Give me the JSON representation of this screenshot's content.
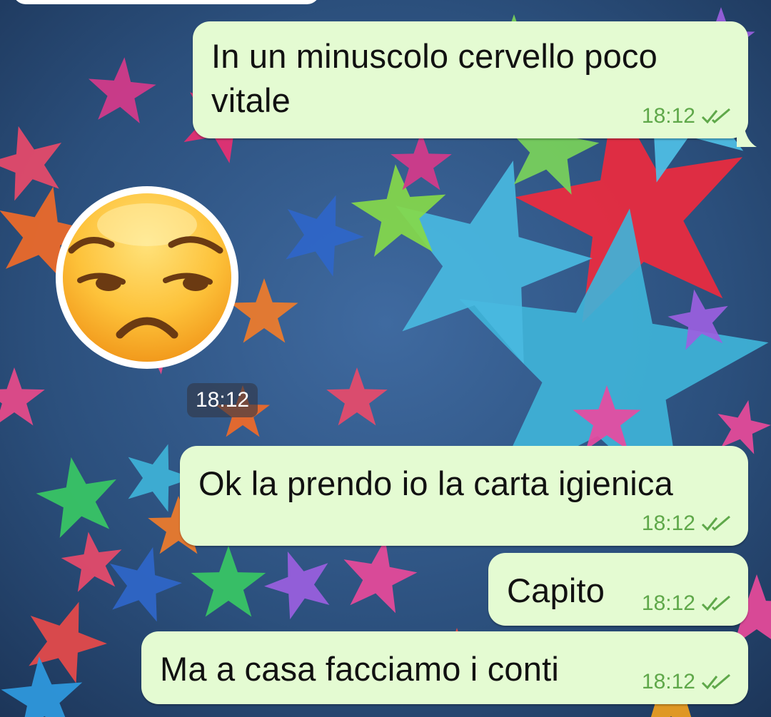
{
  "colors": {
    "bubble_bg": "#e4fbd2",
    "timestamp": "#5fa84a",
    "ticks": "#5fa84a",
    "sticker_time_bg": "#373c4a"
  },
  "wallpaper": {
    "description_icon": "stars-wallpaper"
  },
  "messages": [
    {
      "text": "In un minuscolo cervello poco vitale",
      "time": "18:12",
      "status": "read-double-tick"
    },
    {
      "text": "Ok la prendo io la carta igienica",
      "time": "18:12",
      "status": "read-double-tick"
    },
    {
      "text": "Capito",
      "time": "18:12",
      "status": "read-double-tick"
    },
    {
      "text": "Ma a casa facciamo i conti",
      "time": "18:12",
      "status": "read-double-tick"
    }
  ],
  "sticker": {
    "icon": "unamused-face-emoji",
    "time": "18:12"
  }
}
